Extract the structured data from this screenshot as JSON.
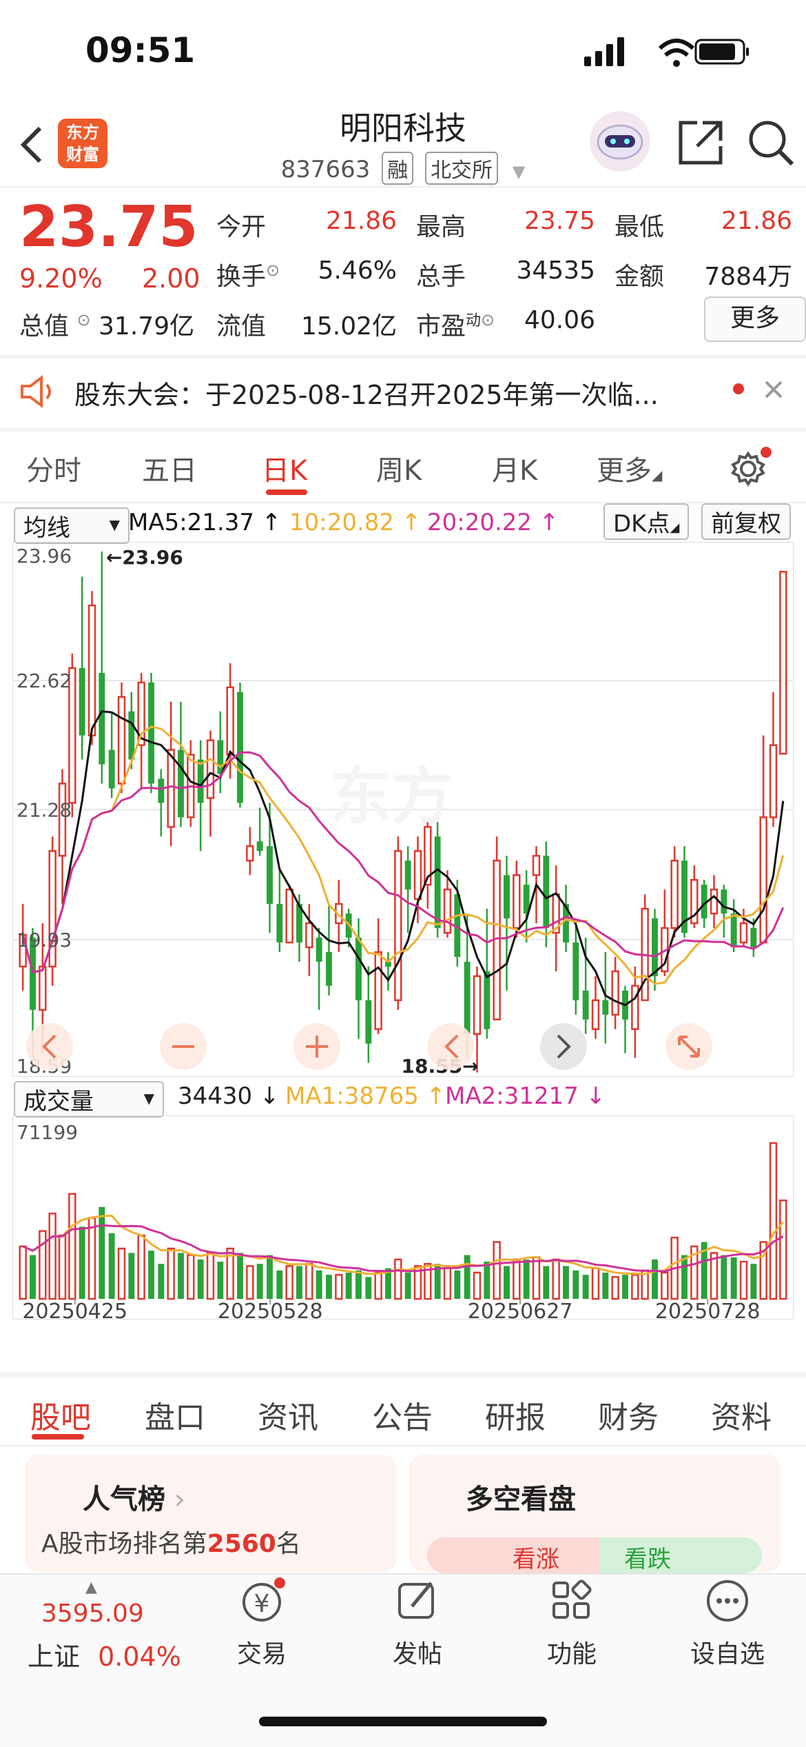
{
  "status": {
    "time": "09:51"
  },
  "header": {
    "logo_line1": "东方",
    "logo_line2": "财富",
    "title": "明阳科技",
    "code": "837663",
    "badge_margin": "融",
    "badge_exchange": "北交所"
  },
  "quote": {
    "price": "23.75",
    "change_pct": "9.20%",
    "change": "2.00",
    "open_label": "今开",
    "open": "21.86",
    "high_label": "最高",
    "high": "23.75",
    "low_label": "最低",
    "low": "21.86",
    "turnover_label": "换手",
    "turnover": "5.46%",
    "volume_label": "总手",
    "volume": "34535",
    "amount_label": "金额",
    "amount": "7884万",
    "mktcap_label": "总值",
    "mktcap": "31.79亿",
    "float_label": "流值",
    "float": "15.02亿",
    "pe_label": "市盈",
    "pe_sup": "动",
    "pe": "40.06",
    "more_label": "更多"
  },
  "notice": {
    "text": "股东大会：于2025-08-12召开2025年第一次临..."
  },
  "period_tabs": [
    "分时",
    "五日",
    "日K",
    "周K",
    "月K",
    "更多"
  ],
  "indicators": {
    "ma_selector": "均线",
    "ma5": "MA5:21.37",
    "ma10": "10:20.82",
    "ma20": "20:20.22",
    "dk_button": "DK点",
    "adjust_button": "前复权",
    "vol_selector": "成交量",
    "vol_now": "34430",
    "vol_ma1": "MA1:38765",
    "vol_ma2": "MA2:31217"
  },
  "colors": {
    "up": "#e0362c",
    "down": "#2aa23a",
    "ma5": "#111111",
    "ma10": "#f0b030",
    "ma20": "#d0309a"
  },
  "chart_data": {
    "type": "candlestick",
    "price_axis_labels": [
      "23.96",
      "22.62",
      "21.28",
      "19.93",
      "18.59"
    ],
    "ylim": [
      18.59,
      23.96
    ],
    "max_marker": "←23.96",
    "min_marker": "18.55→",
    "volume_axis_label": "71199",
    "volume_ylim": [
      0,
      71199
    ],
    "date_labels": [
      "20250425",
      "20250528",
      "20250627",
      "20250728"
    ],
    "candles": [
      [
        19.65,
        19.98,
        20.3,
        19.4
      ],
      [
        19.95,
        19.2,
        20.05,
        18.7
      ],
      [
        19.2,
        19.65,
        20.1,
        18.75
      ],
      [
        19.65,
        20.85,
        21.0,
        19.45
      ],
      [
        20.8,
        21.55,
        21.7,
        20.3
      ],
      [
        21.35,
        22.75,
        22.9,
        21.2
      ],
      [
        22.75,
        22.05,
        23.7,
        21.8
      ],
      [
        22.05,
        23.4,
        23.55,
        21.95
      ],
      [
        22.7,
        21.75,
        23.96,
        21.55
      ],
      [
        21.9,
        21.5,
        22.3,
        21.4
      ],
      [
        21.55,
        22.45,
        22.6,
        21.45
      ],
      [
        22.3,
        21.8,
        22.5,
        21.7
      ],
      [
        21.95,
        22.6,
        22.7,
        21.5
      ],
      [
        22.6,
        21.55,
        22.7,
        21.45
      ],
      [
        21.6,
        21.35,
        21.7,
        21.0
      ],
      [
        21.1,
        21.9,
        22.4,
        20.9
      ],
      [
        21.9,
        21.2,
        22.4,
        21.1
      ],
      [
        21.2,
        21.85,
        22.0,
        21.1
      ],
      [
        21.8,
        21.35,
        22.0,
        20.85
      ],
      [
        21.4,
        22.0,
        22.1,
        21.0
      ],
      [
        22.0,
        21.65,
        22.3,
        21.45
      ],
      [
        21.85,
        22.55,
        22.8,
        21.6
      ],
      [
        22.5,
        21.35,
        22.6,
        21.3
      ],
      [
        20.75,
        20.9,
        21.1,
        20.6
      ],
      [
        20.95,
        20.85,
        21.3,
        20.8
      ],
      [
        20.9,
        20.3,
        21.35,
        20.0
      ],
      [
        20.3,
        19.9,
        20.65,
        19.8
      ],
      [
        19.9,
        20.45,
        20.5,
        19.9
      ],
      [
        20.3,
        19.9,
        20.4,
        19.7
      ],
      [
        19.85,
        20.1,
        20.3,
        19.55
      ],
      [
        19.95,
        19.7,
        20.05,
        19.2
      ],
      [
        19.8,
        19.45,
        20.3,
        19.35
      ],
      [
        20.1,
        20.3,
        20.55,
        19.8
      ],
      [
        20.2,
        19.95,
        20.25,
        19.85
      ],
      [
        19.95,
        19.3,
        20.15,
        18.9
      ],
      [
        19.3,
        18.85,
        19.65,
        18.65
      ],
      [
        19.0,
        19.8,
        20.15,
        18.95
      ],
      [
        19.7,
        19.65,
        19.8,
        19.4
      ],
      [
        19.3,
        20.85,
        21.0,
        19.2
      ],
      [
        20.75,
        20.45,
        20.9,
        20.0
      ],
      [
        20.35,
        20.85,
        21.0,
        20.1
      ],
      [
        20.5,
        21.1,
        21.15,
        20.25
      ],
      [
        21.0,
        20.05,
        21.15,
        19.95
      ],
      [
        20.0,
        20.45,
        20.65,
        19.95
      ],
      [
        20.4,
        19.75,
        20.55,
        19.65
      ],
      [
        19.7,
        18.95,
        20.2,
        18.7
      ],
      [
        18.95,
        19.55,
        19.65,
        18.55
      ],
      [
        19.6,
        19.0,
        20.25,
        18.9
      ],
      [
        19.1,
        20.75,
        21.0,
        19.1
      ],
      [
        20.6,
        20.15,
        20.8,
        19.4
      ],
      [
        20.05,
        20.6,
        20.75,
        19.95
      ],
      [
        20.5,
        20.2,
        20.65,
        19.9
      ],
      [
        20.6,
        20.8,
        20.9,
        20.1
      ],
      [
        20.8,
        20.05,
        20.95,
        19.85
      ],
      [
        20.0,
        20.4,
        20.7,
        19.6
      ],
      [
        20.3,
        19.9,
        20.5,
        19.8
      ],
      [
        19.9,
        19.3,
        20.1,
        19.15
      ],
      [
        19.4,
        19.1,
        19.95,
        18.95
      ],
      [
        19.0,
        19.3,
        19.55,
        18.9
      ],
      [
        19.3,
        19.15,
        19.8,
        18.85
      ],
      [
        19.15,
        19.6,
        19.75,
        19.0
      ],
      [
        19.4,
        19.1,
        19.45,
        18.75
      ],
      [
        19.0,
        19.45,
        19.65,
        18.7
      ],
      [
        19.3,
        20.25,
        20.4,
        19.3
      ],
      [
        20.15,
        19.55,
        20.25,
        19.4
      ],
      [
        19.6,
        20.05,
        20.45,
        19.55
      ],
      [
        20.05,
        20.75,
        20.9,
        19.95
      ],
      [
        20.75,
        20.0,
        20.9,
        19.95
      ],
      [
        20.1,
        20.55,
        20.7,
        20.05
      ],
      [
        20.5,
        20.15,
        20.55,
        20.05
      ],
      [
        20.2,
        20.45,
        20.6,
        20.05
      ],
      [
        20.45,
        20.2,
        20.5,
        19.95
      ],
      [
        20.2,
        19.85,
        20.35,
        19.8
      ],
      [
        19.9,
        20.1,
        20.25,
        19.85
      ],
      [
        20.05,
        19.85,
        20.15,
        19.75
      ],
      [
        19.9,
        21.2,
        22.05,
        19.9
      ],
      [
        21.2,
        21.95,
        22.5,
        21.1
      ],
      [
        21.86,
        23.75,
        23.75,
        21.86
      ]
    ],
    "volumes": [
      24000,
      20000,
      31000,
      39000,
      29000,
      48000,
      33000,
      37000,
      42000,
      30000,
      23000,
      21000,
      29000,
      22000,
      16000,
      23000,
      21000,
      20000,
      18000,
      21000,
      17000,
      23000,
      21000,
      15000,
      16000,
      20000,
      13000,
      15000,
      15000,
      16000,
      13000,
      11000,
      11000,
      12000,
      13000,
      10000,
      12000,
      14000,
      18000,
      12000,
      15000,
      16000,
      16000,
      15000,
      13000,
      20000,
      12000,
      17000,
      26000,
      15000,
      18000,
      18000,
      19000,
      15000,
      18000,
      15000,
      13000,
      11000,
      14000,
      12000,
      10000,
      11000,
      11000,
      13000,
      18000,
      12000,
      28000,
      20000,
      24000,
      26000,
      21000,
      20000,
      19000,
      17000,
      16000,
      26000,
      71199,
      45000
    ]
  },
  "bottom_tabs": [
    "股吧",
    "盘口",
    "资讯",
    "公告",
    "研报",
    "财务",
    "资料"
  ],
  "cards": {
    "popularity_title": "人气榜",
    "popularity_text_pre": "A股市场排名第",
    "popularity_rank": "2560",
    "popularity_text_post": "名",
    "sentiment_title": "多空看盘",
    "bull_label": "看涨",
    "bear_label": "看跌"
  },
  "bottom_nav": {
    "index_value": "3595.09",
    "index_name": "上证",
    "index_change": "0.04%",
    "items": [
      {
        "label": "交易",
        "icon": "yen-swap-icon"
      },
      {
        "label": "发帖",
        "icon": "pencil-icon"
      },
      {
        "label": "功能",
        "icon": "grid-icon"
      },
      {
        "label": "设自选",
        "icon": "more-icon"
      }
    ]
  }
}
